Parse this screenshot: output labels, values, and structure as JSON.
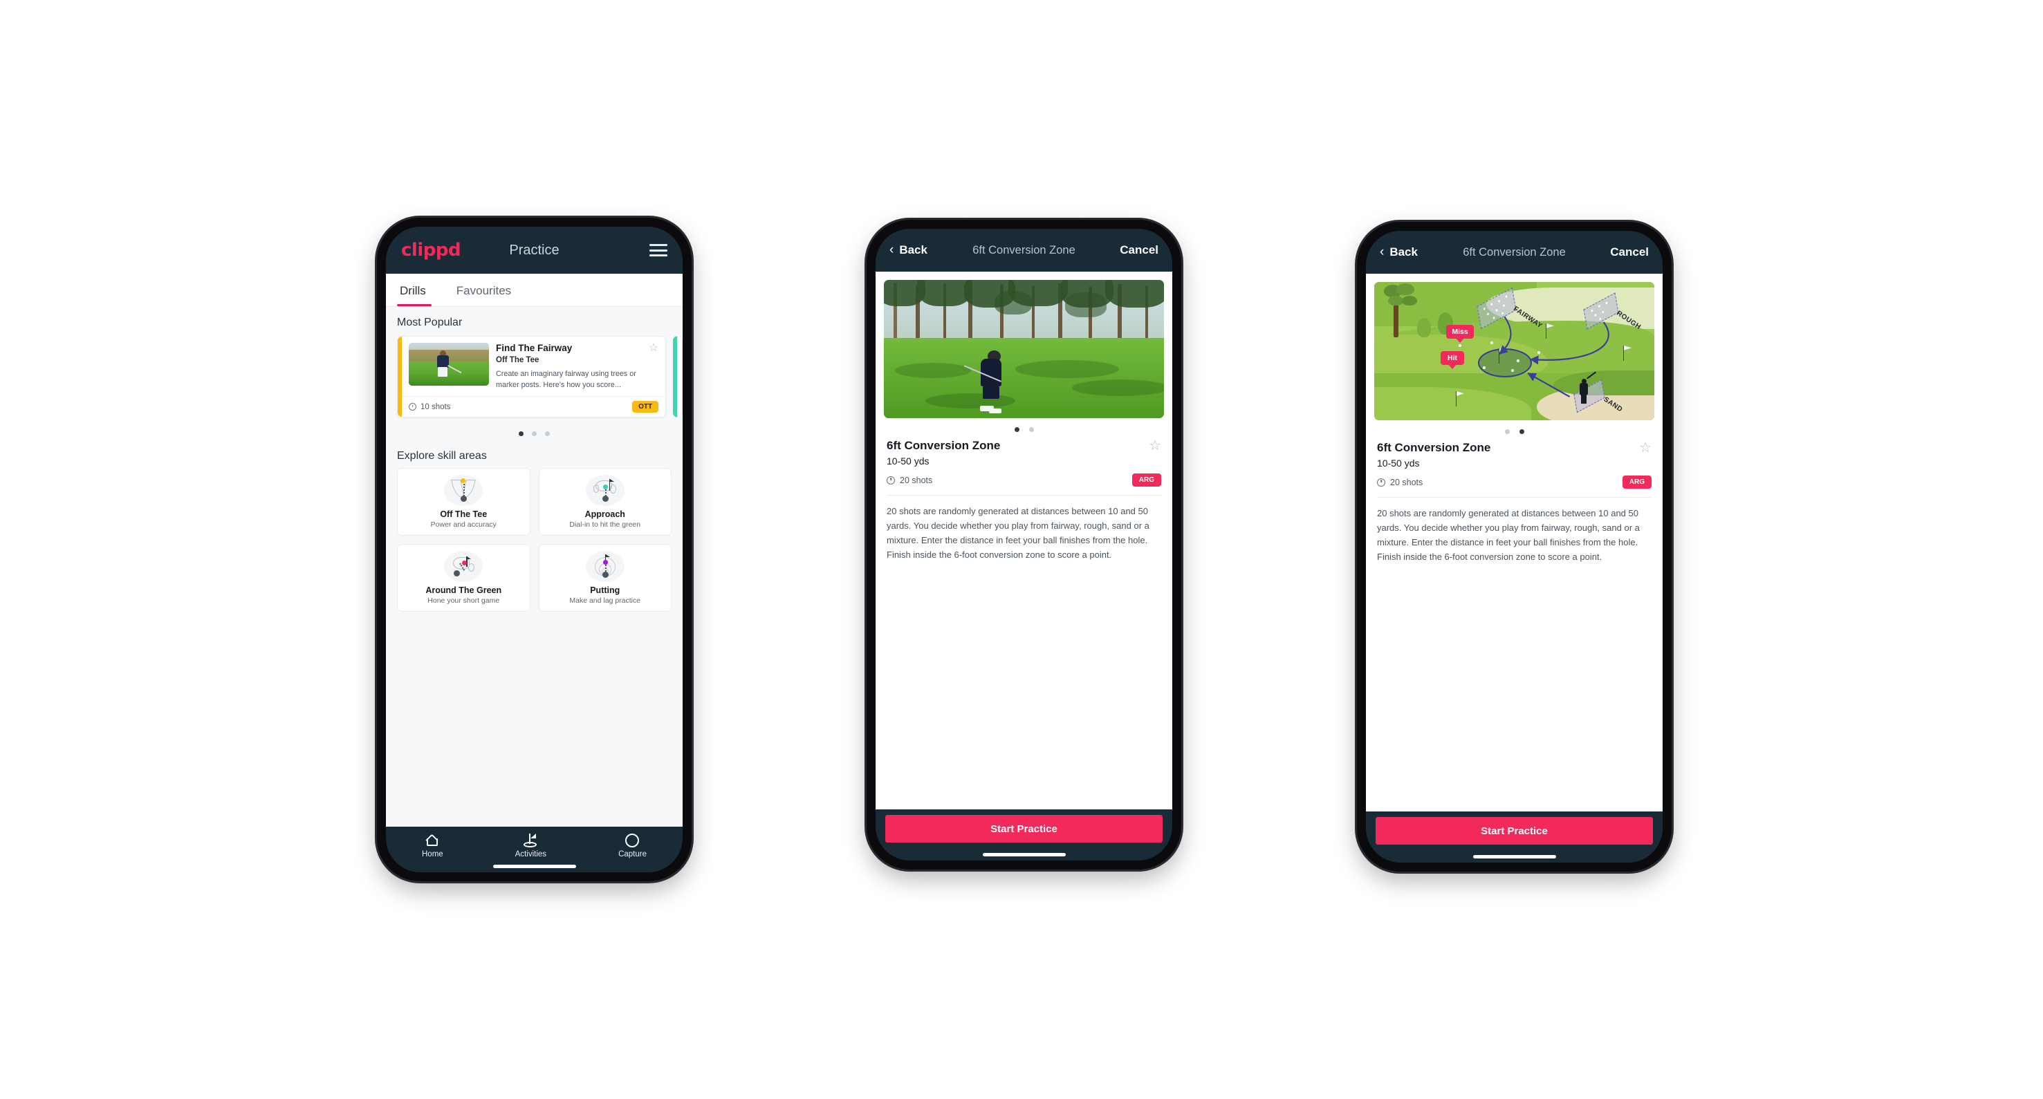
{
  "brand": "clippd",
  "phone1": {
    "appbar": {
      "title": "Practice",
      "menu_icon": "hamburger-icon"
    },
    "tabs": [
      {
        "label": "Drills",
        "active": true
      },
      {
        "label": "Favourites",
        "active": false
      }
    ],
    "sections": {
      "most_popular": "Most Popular",
      "explore": "Explore skill areas"
    },
    "drill_card": {
      "title": "Find The Fairway",
      "subtitle": "Off The Tee",
      "description": "Create an imaginary fairway using trees or marker posts. Here's how you score...",
      "shots": "10 shots",
      "chip": "OTT",
      "chip_color": "#f9ba14",
      "accent_color": "#f9ba14",
      "next_accent_color": "#3ed6b0",
      "star_icon": "star-outline-icon",
      "clock_icon": "clock-icon"
    },
    "carousel": {
      "count": 3,
      "active_index": 0
    },
    "skills": [
      {
        "name": "Off The Tee",
        "desc": "Power and accuracy",
        "icon": "tee-fan-icon",
        "accent": "#f9ba14"
      },
      {
        "name": "Approach",
        "desc": "Dial-in to hit the green",
        "icon": "approach-green-icon",
        "accent": "#2ed3b7"
      },
      {
        "name": "Around The Green",
        "desc": "Hone your short game",
        "icon": "chip-green-icon",
        "accent": "#f2295b"
      },
      {
        "name": "Putting",
        "desc": "Make and lag practice",
        "icon": "putting-rings-icon",
        "accent": "#a41ad6"
      }
    ],
    "tabbar": [
      {
        "label": "Home",
        "icon": "home-icon",
        "active": false
      },
      {
        "label": "Activities",
        "icon": "golf-flag-icon",
        "active": true
      },
      {
        "label": "Capture",
        "icon": "plus-circle-icon",
        "active": false
      }
    ]
  },
  "phone2": {
    "navbar": {
      "back": "Back",
      "title": "6ft Conversion Zone",
      "cancel": "Cancel",
      "back_icon": "chevron-left-icon"
    },
    "hero": {
      "type": "photo",
      "alt": "golfer-chipping-photo"
    },
    "carousel": {
      "count": 2,
      "active_index": 0
    },
    "detail": {
      "title": "6ft Conversion Zone",
      "subtitle": "10-50 yds",
      "shots": "20 shots",
      "chip": "ARG",
      "chip_color": "#f2295b",
      "star_icon": "star-outline-icon",
      "clock_icon": "clock-icon",
      "description": "20 shots are randomly generated at distances between 10 and 50 yards. You decide whether you play from fairway, rough, sand or a mixture. Enter the distance in feet your ball finishes from the hole. Finish inside the 6-foot conversion zone to score a point."
    },
    "cta": "Start Practice",
    "cta_color": "#f2295b"
  },
  "phone3": {
    "navbar": {
      "back": "Back",
      "title": "6ft Conversion Zone",
      "cancel": "Cancel",
      "back_icon": "chevron-left-icon"
    },
    "hero": {
      "type": "illustration",
      "alt": "golf-course-diagram",
      "labels": [
        "FAIRWAY",
        "ROUGH",
        "SAND"
      ],
      "tags": [
        "Miss",
        "Hit"
      ]
    },
    "carousel": {
      "count": 2,
      "active_index": 1
    },
    "detail": {
      "title": "6ft Conversion Zone",
      "subtitle": "10-50 yds",
      "shots": "20 shots",
      "chip": "ARG",
      "chip_color": "#f2295b",
      "star_icon": "star-outline-icon",
      "clock_icon": "clock-icon",
      "description": "20 shots are randomly generated at distances between 10 and 50 yards. You decide whether you play from fairway, rough, sand or a mixture. Enter the distance in feet your ball finishes from the hole. Finish inside the 6-foot conversion zone to score a point."
    },
    "cta": "Start Practice",
    "cta_color": "#f2295b"
  }
}
